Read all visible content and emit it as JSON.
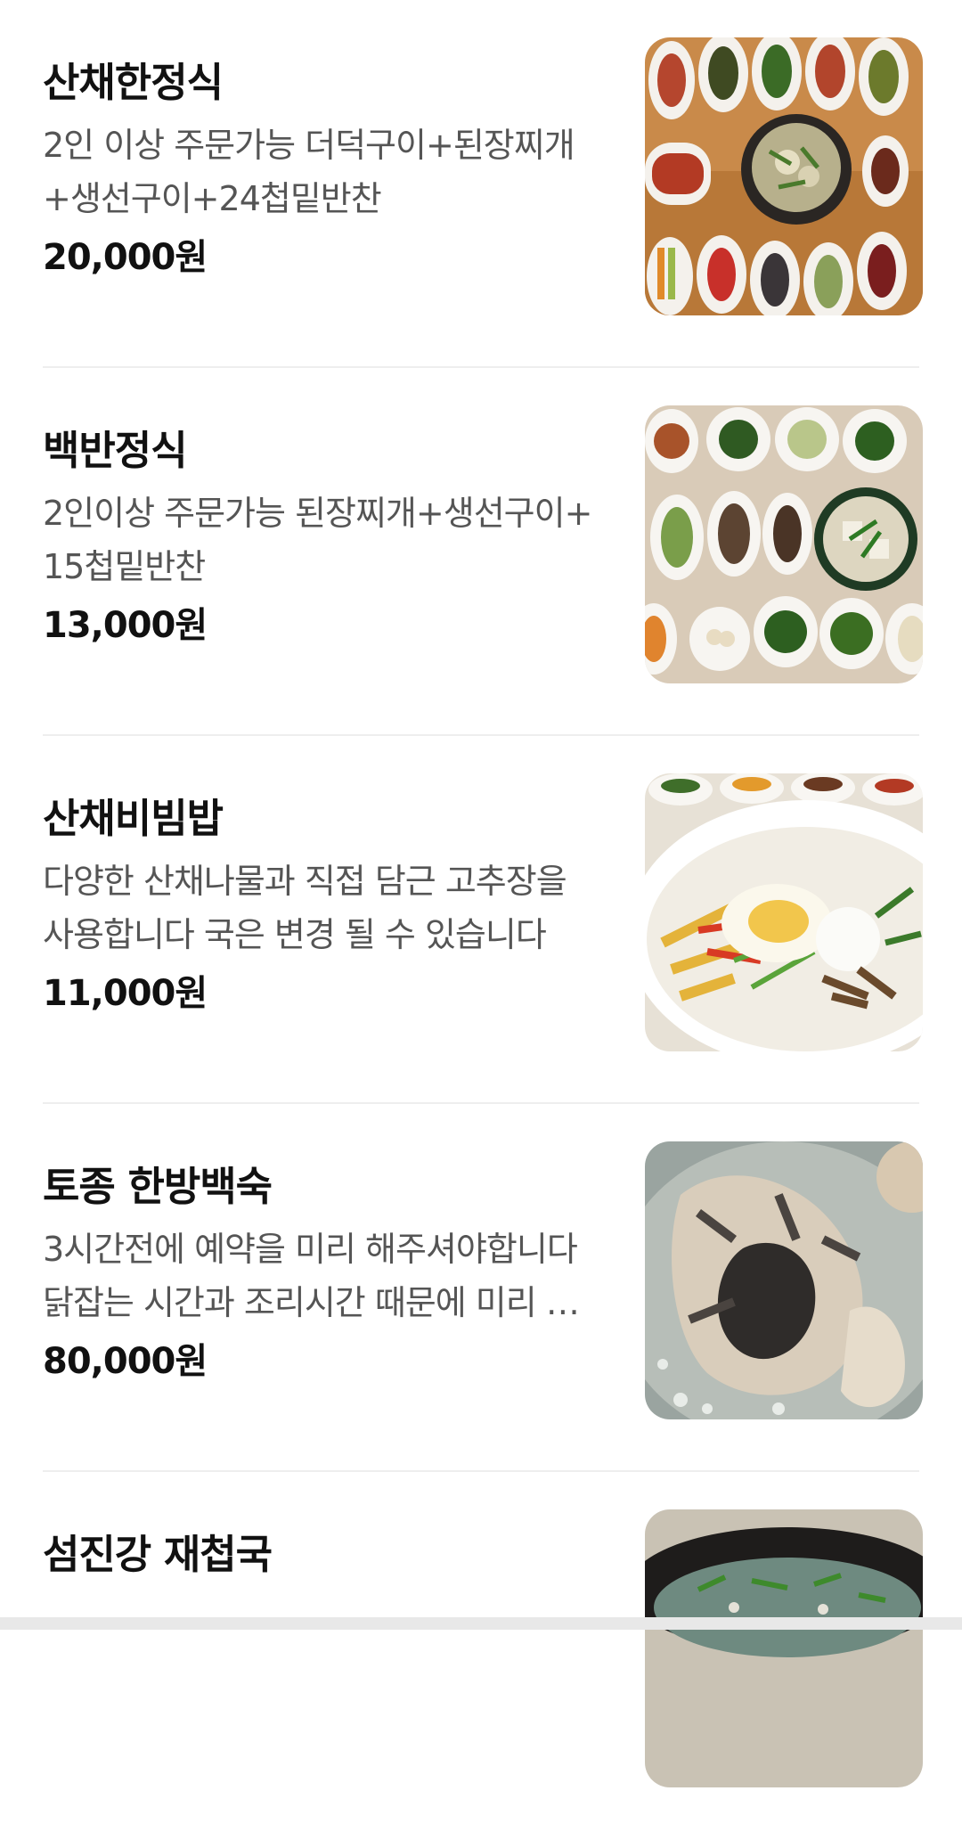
{
  "menu": {
    "items": [
      {
        "name": "산채한정식",
        "description": "2인 이상 주문가능 더덕구이+된장찌개+생선구이+24첩밑반찬",
        "price": "20,000원"
      },
      {
        "name": "백반정식",
        "description": "2인이상 주문가능 된장찌개+생선구이+15첩밑반찬",
        "price": "13,000원"
      },
      {
        "name": "산채비빔밥",
        "description": "다양한 산채나물과 직접 담근 고추장을 사용합니다 국은 변경 될 수 있습니다",
        "price": "11,000원"
      },
      {
        "name": "토종 한방백숙",
        "description": "3시간전에 예약을 미리 해주셔야합니다 닭잡는 시간과 조리시간 때문에 미리 예약해주세요",
        "price": "80,000원"
      },
      {
        "name": "섬진강 재첩국",
        "description": "",
        "price": ""
      }
    ]
  },
  "images": [
    "korean-table-setting-photo",
    "korean-side-dishes-photo",
    "bibimbap-photo",
    "herbal-chicken-soup-photo",
    "clam-soup-photo"
  ]
}
